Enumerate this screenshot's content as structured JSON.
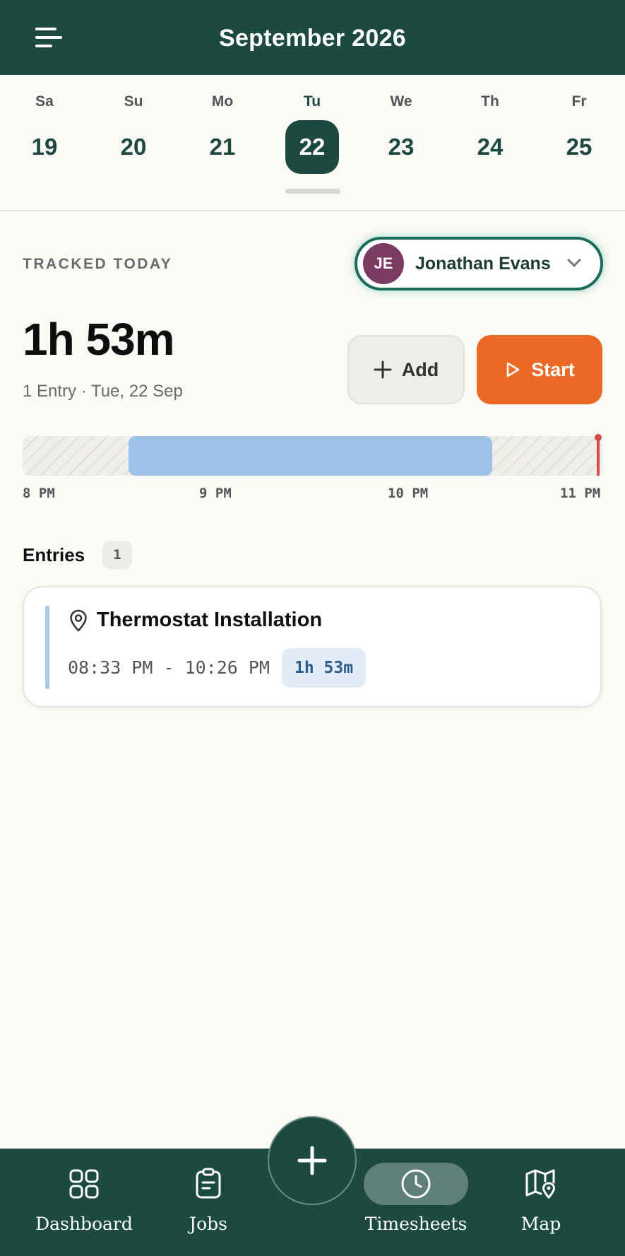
{
  "header": {
    "title": "September 2026"
  },
  "week": {
    "days": [
      {
        "name": "Sa",
        "num": "19"
      },
      {
        "name": "Su",
        "num": "20"
      },
      {
        "name": "Mo",
        "num": "21"
      },
      {
        "name": "Tu",
        "num": "22",
        "selected": true
      },
      {
        "name": "We",
        "num": "23"
      },
      {
        "name": "Th",
        "num": "24"
      },
      {
        "name": "Fr",
        "num": "25"
      }
    ]
  },
  "tracked": {
    "label": "TRACKED TODAY",
    "total": "1h 53m",
    "subline": "1 Entry · Tue, 22 Sep"
  },
  "user": {
    "initials": "JE",
    "name": "Jonathan Evans",
    "avatar_color": "#7a3a62"
  },
  "actions": {
    "add_label": "Add",
    "start_label": "Start"
  },
  "timeline": {
    "ticks": [
      "8 PM",
      "9 PM",
      "10 PM",
      "11 PM"
    ],
    "range_start": "8 PM",
    "range_end": "11 PM",
    "block_start": "08:33 PM",
    "block_end": "10:26 PM"
  },
  "entries": {
    "title": "Entries",
    "count": "1",
    "items": [
      {
        "title": "Thermostat Installation",
        "time_range": "08:33 PM - 10:26 PM",
        "duration": "1h 53m"
      }
    ]
  },
  "nav": {
    "items": [
      {
        "label": "Dashboard",
        "icon": "grid-icon"
      },
      {
        "label": "Jobs",
        "icon": "clipboard-icon"
      },
      {
        "label": "Timesheets",
        "icon": "clock-icon",
        "active": true
      },
      {
        "label": "Map",
        "icon": "map-pin-icon"
      }
    ]
  },
  "colors": {
    "brand": "#1d4a40",
    "accent": "#ea6a25",
    "timeline_block": "#9ec3e8",
    "now_marker": "#d34a4a"
  }
}
